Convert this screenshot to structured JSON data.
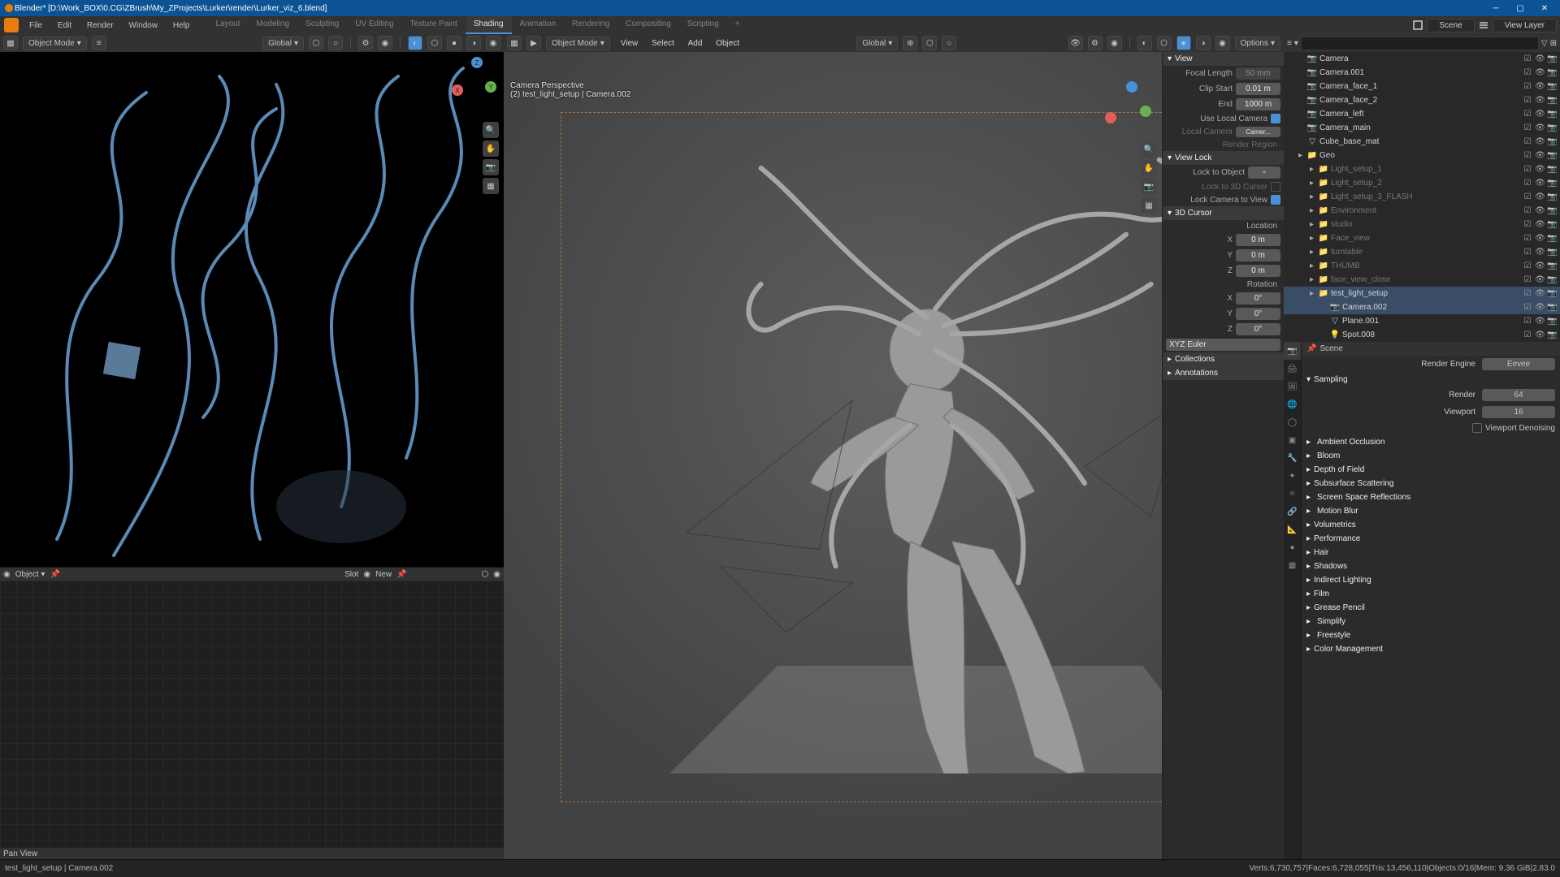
{
  "title": "Blender* [D:\\Work_BOX\\0.CG\\ZBrush\\My_ZProjects\\Lurker\\render\\Lurker_viz_6.blend]",
  "file_menus": [
    "File",
    "Edit",
    "Render",
    "Window",
    "Help"
  ],
  "workspaces": [
    "Layout",
    "Modeling",
    "Sculpting",
    "UV Editing",
    "Texture Paint",
    "Shading",
    "Animation",
    "Rendering",
    "Compositing",
    "Scripting"
  ],
  "workspace_active": "Shading",
  "topbar_scene": "Scene",
  "topbar_viewlayer": "View Layer",
  "left_vp": {
    "mode": "Object Mode",
    "orientation": "Global"
  },
  "mid_vp": {
    "mode": "Object Mode",
    "orientation": "Global",
    "menus": [
      "View",
      "Select",
      "Add",
      "Object"
    ],
    "options_btn": "Options",
    "cam_title": "Camera Perspective",
    "cam_sub": "(2) test_light_setup | Camera.002"
  },
  "npanel": {
    "view": {
      "label": "View",
      "focal_label": "Focal Length",
      "focal_val": "50 mm",
      "clip_start_label": "Clip Start",
      "clip_start_val": "0.01 m",
      "clip_end_label": "End",
      "clip_end_val": "1000 m",
      "local_cam_label": "Use Local Camera",
      "local_cam_field": "Camer...",
      "render_region_label": "Render Region"
    },
    "viewlock": {
      "label": "View Lock",
      "obj_label": "Lock to Object",
      "cursor_label": "Lock to 3D Cursor",
      "camview_label": "Lock Camera to View"
    },
    "cursor": {
      "label": "3D Cursor",
      "loc_label": "Location",
      "x": "0 m",
      "y": "0 m",
      "z": "0 m",
      "rot_label": "Rotation",
      "rx": "0°",
      "ry": "0°",
      "rz": "0°",
      "euler": "XYZ Euler"
    },
    "collections": "Collections",
    "annotations": "Annotations"
  },
  "outliner": {
    "search_ph": "",
    "items": [
      {
        "name": "Camera",
        "type": "cam",
        "indent": 1
      },
      {
        "name": "Camera.001",
        "type": "cam",
        "indent": 1
      },
      {
        "name": "Camera_face_1",
        "type": "cam",
        "indent": 1
      },
      {
        "name": "Camera_face_2",
        "type": "cam",
        "indent": 1
      },
      {
        "name": "Camera_left",
        "type": "cam",
        "indent": 1
      },
      {
        "name": "Camera_main",
        "type": "cam",
        "indent": 1
      },
      {
        "name": "Cube_base_mat",
        "type": "mesh",
        "indent": 1
      },
      {
        "name": "Geo",
        "type": "coll",
        "indent": 1,
        "expandable": true
      },
      {
        "name": "Light_setup_1",
        "type": "coll",
        "indent": 2,
        "dim": true,
        "expandable": true
      },
      {
        "name": "Light_setup_2",
        "type": "coll",
        "indent": 2,
        "dim": true,
        "expandable": true
      },
      {
        "name": "Light_setup_3_FLASH",
        "type": "coll",
        "indent": 2,
        "dim": true,
        "expandable": true
      },
      {
        "name": "Environment",
        "type": "coll",
        "indent": 2,
        "dim": true,
        "expandable": true
      },
      {
        "name": "studio",
        "type": "coll",
        "indent": 2,
        "dim": true,
        "expandable": true
      },
      {
        "name": "Face_view",
        "type": "coll",
        "indent": 2,
        "dim": true,
        "expandable": true
      },
      {
        "name": "turntable",
        "type": "coll",
        "indent": 2,
        "dim": true,
        "expandable": true
      },
      {
        "name": "THUMB",
        "type": "coll",
        "indent": 2,
        "dim": true,
        "expandable": true
      },
      {
        "name": "face_view_close",
        "type": "coll",
        "indent": 2,
        "dim": true,
        "expandable": true
      },
      {
        "name": "test_light_setup",
        "type": "coll",
        "indent": 2,
        "active": true,
        "expandable": true
      },
      {
        "name": "Camera.002",
        "type": "cam",
        "indent": 3,
        "active": true
      },
      {
        "name": "Plane.001",
        "type": "mesh",
        "indent": 3
      },
      {
        "name": "Spot.008",
        "type": "light",
        "indent": 3
      }
    ]
  },
  "props": {
    "breadcrumb": "Scene",
    "engine_label": "Render Engine",
    "engine_val": "Eevee",
    "sampling": "Sampling",
    "render_label": "Render",
    "render_val": "64",
    "viewport_label": "Viewport",
    "viewport_val": "16",
    "denoise": "Viewport Denoising",
    "panels": [
      {
        "label": "Ambient Occlusion",
        "ck": true
      },
      {
        "label": "Bloom",
        "ck": true
      },
      {
        "label": "Depth of Field"
      },
      {
        "label": "Subsurface Scattering"
      },
      {
        "label": "Screen Space Reflections",
        "ck": true
      },
      {
        "label": "Motion Blur",
        "ck": false
      },
      {
        "label": "Volumetrics"
      },
      {
        "label": "Performance"
      },
      {
        "label": "Hair"
      },
      {
        "label": "Shadows"
      },
      {
        "label": "Indirect Lighting"
      },
      {
        "label": "Film"
      },
      {
        "label": "Grease Pencil"
      },
      {
        "label": "Simplify",
        "ck": false
      },
      {
        "label": "Freestyle",
        "ck": false
      },
      {
        "label": "Color Management"
      }
    ]
  },
  "node_editor": {
    "mode": "Object",
    "slotlabel": "Slot",
    "newlabel": "New",
    "footer_hint": "Pan View"
  },
  "status": {
    "path": "test_light_setup | Camera.002",
    "verts": "Verts:6,730,757",
    "faces": "Faces:6,728,055",
    "tris": "Tris:13,456,110",
    "objects": "Objects:0/16",
    "mem": "Mem: 9.36 GiB",
    "ver": "2.83.0"
  }
}
